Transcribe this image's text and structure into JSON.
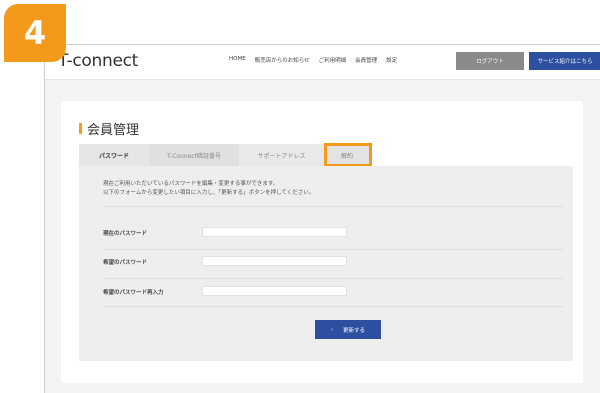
{
  "step_badge": "4",
  "header": {
    "logo": "T-connect",
    "nav": [
      "HOME",
      "販売店からのお知らせ",
      "ご利用明細",
      "会員管理",
      "設定"
    ],
    "logout_label": "ログアウト",
    "service_label": "サービス紹介はこちら"
  },
  "main": {
    "title": "会員管理",
    "tabs": [
      {
        "label": "パスワード"
      },
      {
        "label": "T-Connect暗証番号"
      },
      {
        "label": "サポートアドレス"
      },
      {
        "label": "解約"
      }
    ],
    "intro": [
      "現在ご利用いただいているパスワードを編集・変更する事ができます。",
      "以下のフォームから変更したい項目に入力し、「更新する」ボタンを押してください。"
    ],
    "fields": [
      {
        "label": "現在のパスワード",
        "value": ""
      },
      {
        "label": "希望のパスワード",
        "value": ""
      },
      {
        "label": "希望のパスワード再入力",
        "value": ""
      }
    ],
    "submit_label": "更新する",
    "submit_arrow": "›"
  },
  "colors": {
    "highlight": "#f39a1d",
    "primary": "#2c4fa0",
    "logout": "#8a8a8a"
  }
}
